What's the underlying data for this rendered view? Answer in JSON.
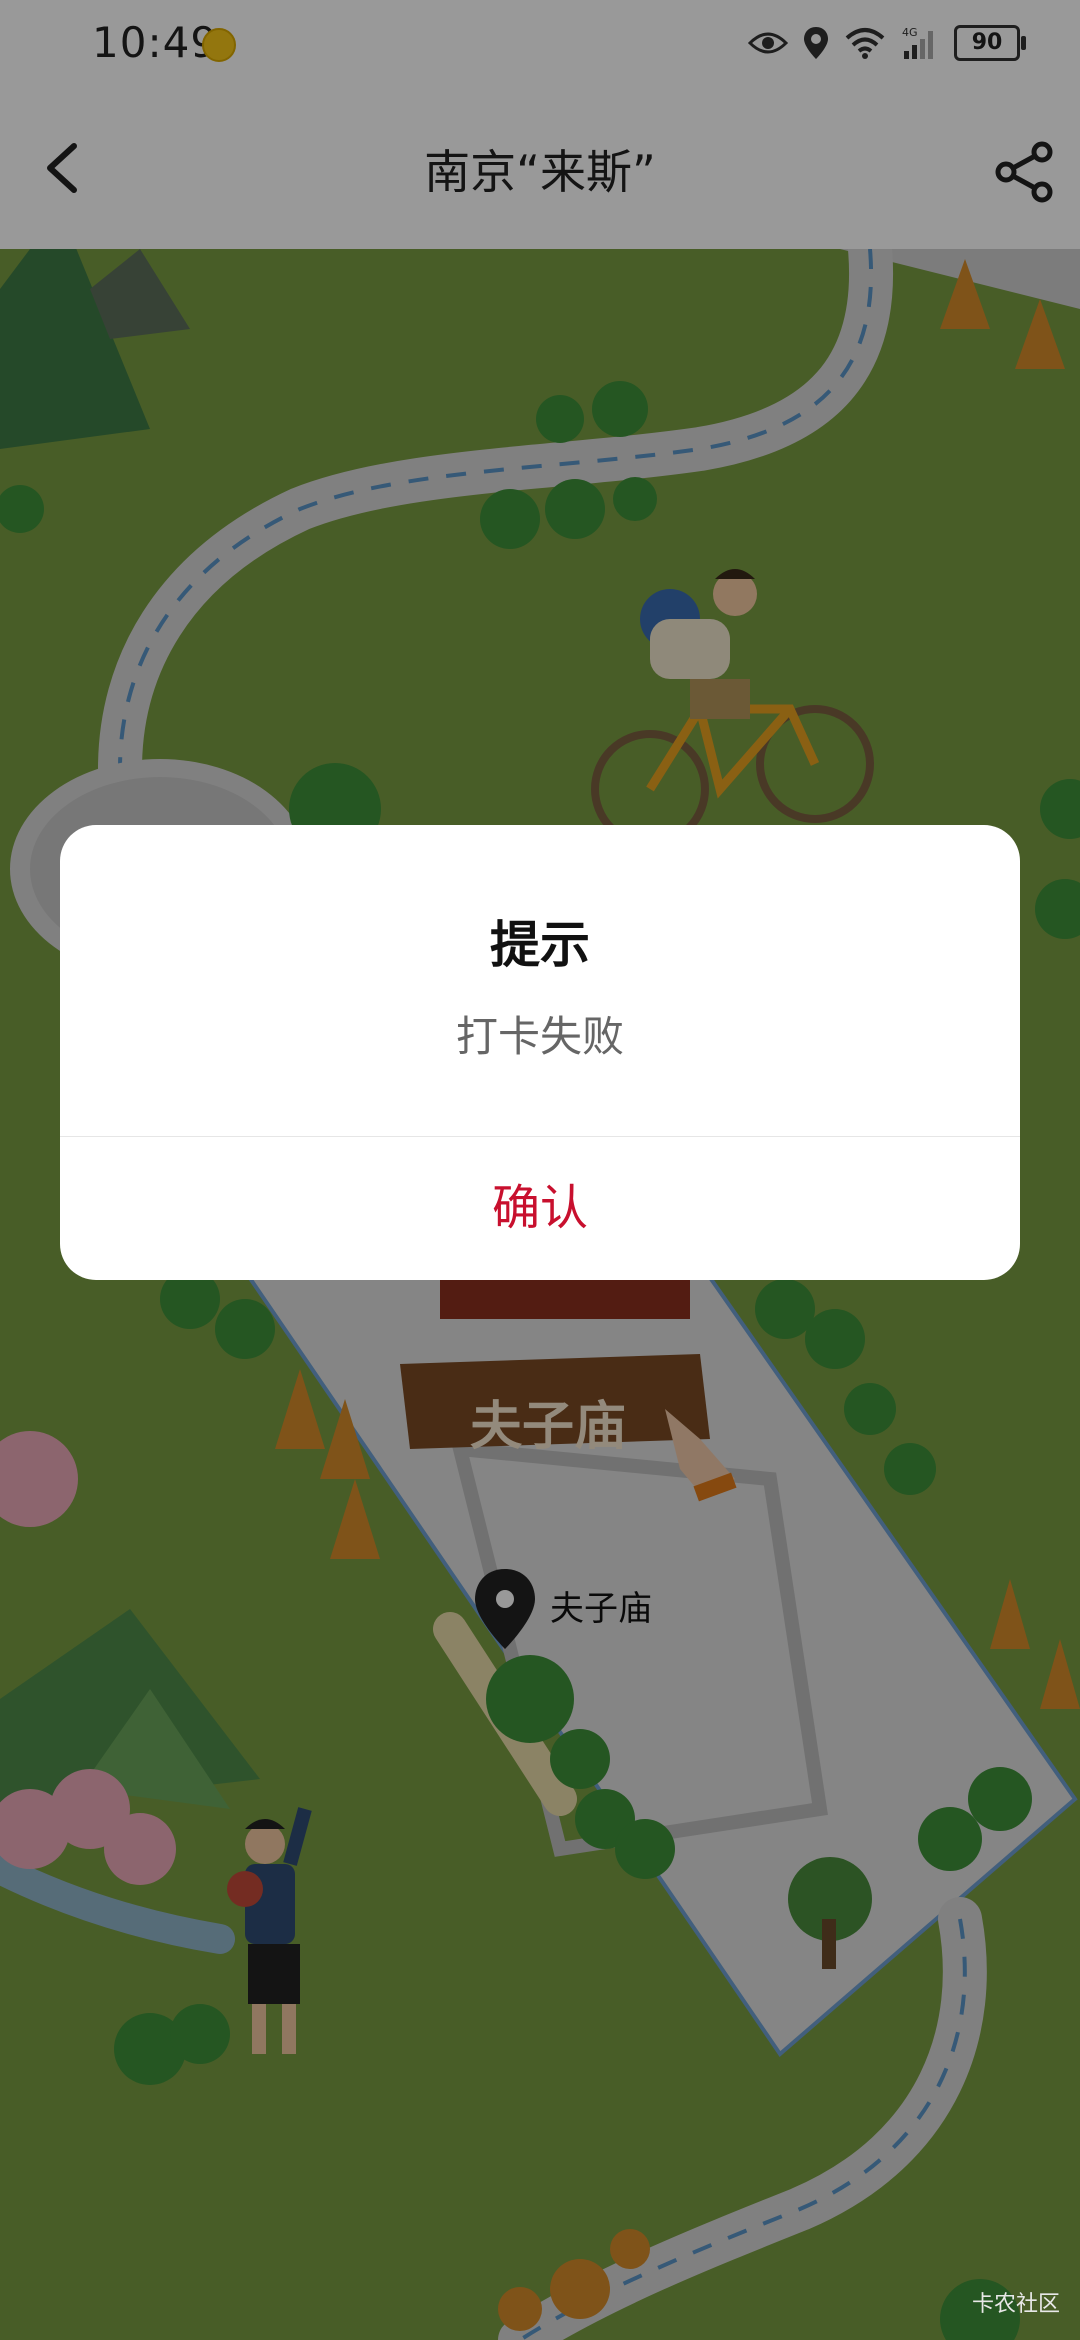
{
  "status_bar": {
    "time": "10:49",
    "battery": "90"
  },
  "nav": {
    "title": "南京“来斯”"
  },
  "map": {
    "badge_text": "夫子庙",
    "pin_label": "夫子庙"
  },
  "dialog": {
    "title": "提示",
    "message": "打卡失败",
    "confirm_label": "确认"
  },
  "watermark": "卡农社区",
  "colors": {
    "accent": "#c8102e",
    "map_grass": "#789b41",
    "path": "#d8d8d8"
  }
}
